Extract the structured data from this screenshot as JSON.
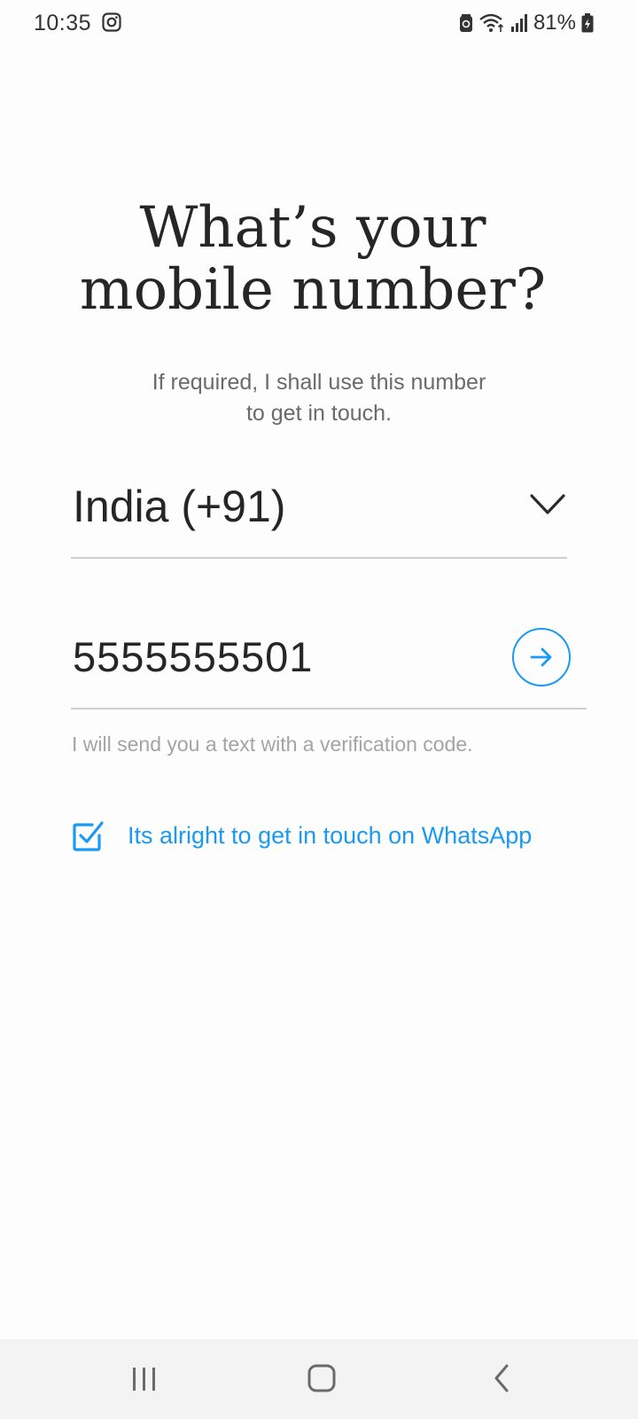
{
  "status_bar": {
    "time": "10:35",
    "battery": "81%",
    "icons": [
      "instagram-icon",
      "battery-saver-icon",
      "wifi-icon",
      "signal-icon",
      "battery-icon"
    ]
  },
  "header": {
    "title_line1": "What’s your",
    "title_line2": "mobile number?",
    "subtitle_line1": "If required, I shall use this number",
    "subtitle_line2": "to get in touch."
  },
  "form": {
    "country": "India (+91)",
    "phone_value": "5555555501",
    "helper_text": "I will send you a text with a verification code.",
    "whatsapp_label": "Its alright to get in touch on WhatsApp",
    "whatsapp_checked": true
  },
  "colors": {
    "accent": "#1a9af2",
    "text": "#262626",
    "muted": "#a4a4a4",
    "background": "#fdfdfd"
  },
  "nav_bar": {
    "icons": [
      "recents-icon",
      "home-icon",
      "back-icon"
    ]
  }
}
